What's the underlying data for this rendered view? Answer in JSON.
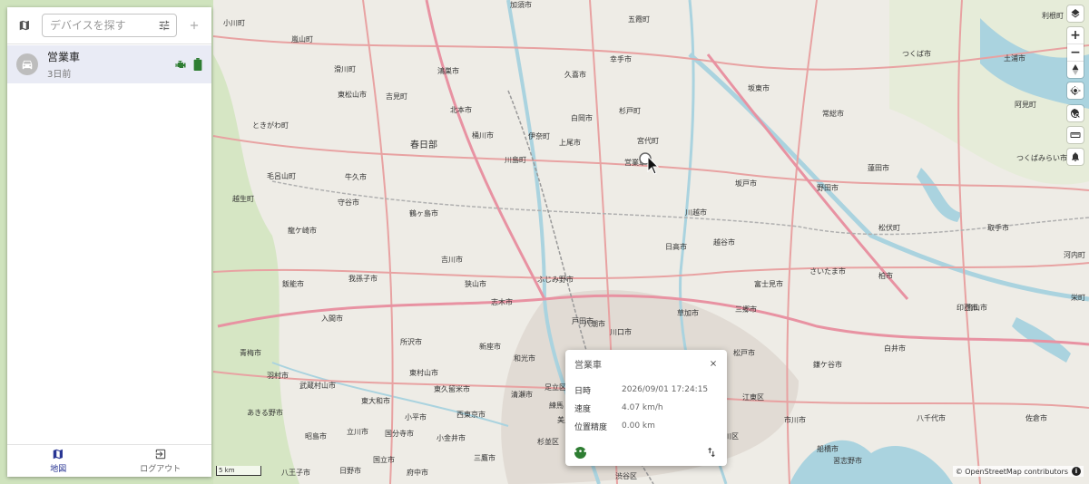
{
  "search": {
    "placeholder": "デバイスを探す"
  },
  "devices": [
    {
      "name": "営業車",
      "last_seen": "3日前"
    }
  ],
  "nav": [
    {
      "label": "地図",
      "icon": "map-icon"
    },
    {
      "label": "ログアウト",
      "icon": "logout-icon"
    }
  ],
  "popup": {
    "title": "営業車",
    "rows": [
      {
        "key": "日時",
        "value": "2026/09/01 17:24:15"
      },
      {
        "key": "速度",
        "value": "4.07 km/h"
      },
      {
        "key": "位置精度",
        "value": "0.00 km"
      }
    ]
  },
  "map": {
    "scale_label": "5 km",
    "attribution": "© OpenStreetMap contributors",
    "places": [
      {
        "name": "加須市"
      },
      {
        "name": "五霞町"
      },
      {
        "name": "つくば市"
      },
      {
        "name": "土浦市"
      },
      {
        "name": "鴻巣市"
      },
      {
        "name": "久喜市"
      },
      {
        "name": "幸手市"
      },
      {
        "name": "坂東市"
      },
      {
        "name": "東松山市"
      },
      {
        "name": "吉見町"
      },
      {
        "name": "北本市"
      },
      {
        "name": "白岡市"
      },
      {
        "name": "杉戸町"
      },
      {
        "name": "常総市"
      },
      {
        "name": "阿見町"
      },
      {
        "name": "桶川市"
      },
      {
        "name": "伊奈町"
      },
      {
        "name": "宮代町"
      },
      {
        "name": "営業車"
      },
      {
        "name": "春日部"
      },
      {
        "name": "川島町"
      },
      {
        "name": "上尾市"
      },
      {
        "name": "蓮田市"
      },
      {
        "name": "つくばみらい市"
      },
      {
        "name": "牛久市"
      },
      {
        "name": "坂戸市"
      },
      {
        "name": "野田市"
      },
      {
        "name": "守谷市"
      },
      {
        "name": "鶴ヶ島市"
      },
      {
        "name": "川越市"
      },
      {
        "name": "松伏町"
      },
      {
        "name": "取手市"
      },
      {
        "name": "龍ケ崎市"
      },
      {
        "name": "日高市"
      },
      {
        "name": "越谷市"
      },
      {
        "name": "吉川市"
      },
      {
        "name": "ふじみ野市"
      },
      {
        "name": "さいたま市"
      },
      {
        "name": "柏市"
      },
      {
        "name": "我孫子市"
      },
      {
        "name": "狭山市"
      },
      {
        "name": "富士見市"
      },
      {
        "name": "流山市"
      },
      {
        "name": "飯能市"
      },
      {
        "name": "志木市"
      },
      {
        "name": "戸田市"
      },
      {
        "name": "草加市"
      },
      {
        "name": "三郷市"
      },
      {
        "name": "印西市"
      },
      {
        "name": "入間市"
      },
      {
        "name": "川口市"
      },
      {
        "name": "所沢市"
      },
      {
        "name": "新座市"
      },
      {
        "name": "和光市"
      },
      {
        "name": "松戸市"
      },
      {
        "name": "白井市"
      },
      {
        "name": "青梅市"
      },
      {
        "name": "羽村市"
      },
      {
        "name": "東村山市"
      },
      {
        "name": "鎌ケ谷市"
      },
      {
        "name": "武蔵村山市"
      },
      {
        "name": "東久留米市"
      },
      {
        "name": "東大和市"
      },
      {
        "name": "清瀬市"
      },
      {
        "name": "あきる野市"
      },
      {
        "name": "小平市"
      },
      {
        "name": "西東京市"
      },
      {
        "name": "市川市"
      },
      {
        "name": "八千代市"
      },
      {
        "name": "佐倉市"
      },
      {
        "name": "昭島市"
      },
      {
        "name": "立川市"
      },
      {
        "name": "国分寺市"
      },
      {
        "name": "小金井市"
      },
      {
        "name": "杉並区"
      },
      {
        "name": "練馬"
      },
      {
        "name": "江戸川区"
      },
      {
        "name": "船橋市"
      },
      {
        "name": "習志野市"
      },
      {
        "name": "八王子市"
      },
      {
        "name": "日野市"
      },
      {
        "name": "国立市"
      },
      {
        "name": "府中市"
      },
      {
        "name": "三鷹市"
      },
      {
        "name": "渋谷区"
      },
      {
        "name": "江東区"
      },
      {
        "name": "小川町"
      },
      {
        "name": "嵐山町"
      },
      {
        "name": "滑川町"
      },
      {
        "name": "ときがわ町"
      },
      {
        "name": "毛呂山町"
      },
      {
        "name": "越生町"
      },
      {
        "name": "利根町"
      },
      {
        "name": "河内町"
      },
      {
        "name": "栄町"
      },
      {
        "name": "足立区"
      },
      {
        "name": "八潮市"
      },
      {
        "name": "美里町"
      },
      {
        "name": "千代田町"
      }
    ]
  },
  "colors": {
    "accent": "#283593",
    "battery": "#2e7d32",
    "popup_action": "#2e7d32"
  }
}
